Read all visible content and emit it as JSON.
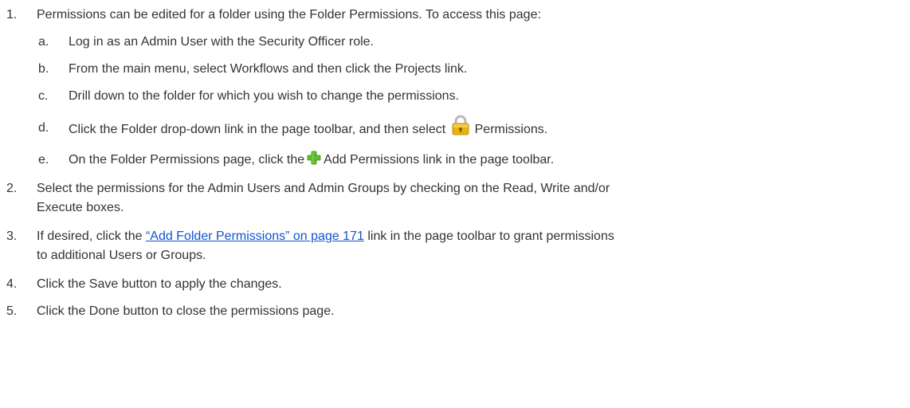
{
  "steps": [
    {
      "number": "1.",
      "text": "Permissions can be edited for a folder using the Folder Permissions. To access this page:",
      "substeps": [
        {
          "letter": "a.",
          "text": "Log in as an Admin User with the Security Officer role."
        },
        {
          "letter": "b.",
          "text": "From the main menu, select Workflows and then click the Projects link."
        },
        {
          "letter": "c.",
          "text": "Drill down to the folder for which you wish to change the permissions."
        },
        {
          "letter": "d.",
          "text_before": "Click the Folder drop-down link in the page toolbar, and then select",
          "icon": "lock-icon",
          "text_after": "Permissions."
        },
        {
          "letter": "e.",
          "text_before": "On the Folder Permissions page, click the",
          "icon": "plus-icon",
          "text_after": "Add Permissions link in the page toolbar."
        }
      ]
    },
    {
      "number": "2.",
      "lines": [
        "Select the permissions for the Admin Users and Admin Groups by checking on the Read, Write and/or",
        "Execute boxes."
      ]
    },
    {
      "number": "3.",
      "text_before": "If desired, click the",
      "link": "“Add Folder Permissions” on page 171",
      "text_after": "link in the page toolbar to grant permissions",
      "line2": "to additional Users or Groups."
    },
    {
      "number": "4.",
      "text": "Click the Save button to apply the changes."
    },
    {
      "number": "5.",
      "text": "Click the Done button to close the permissions page."
    }
  ],
  "colors": {
    "text": "#333333",
    "link": "#1155cc",
    "lock_body": "#e8b20e",
    "plus_green": "#5bbf2a"
  }
}
